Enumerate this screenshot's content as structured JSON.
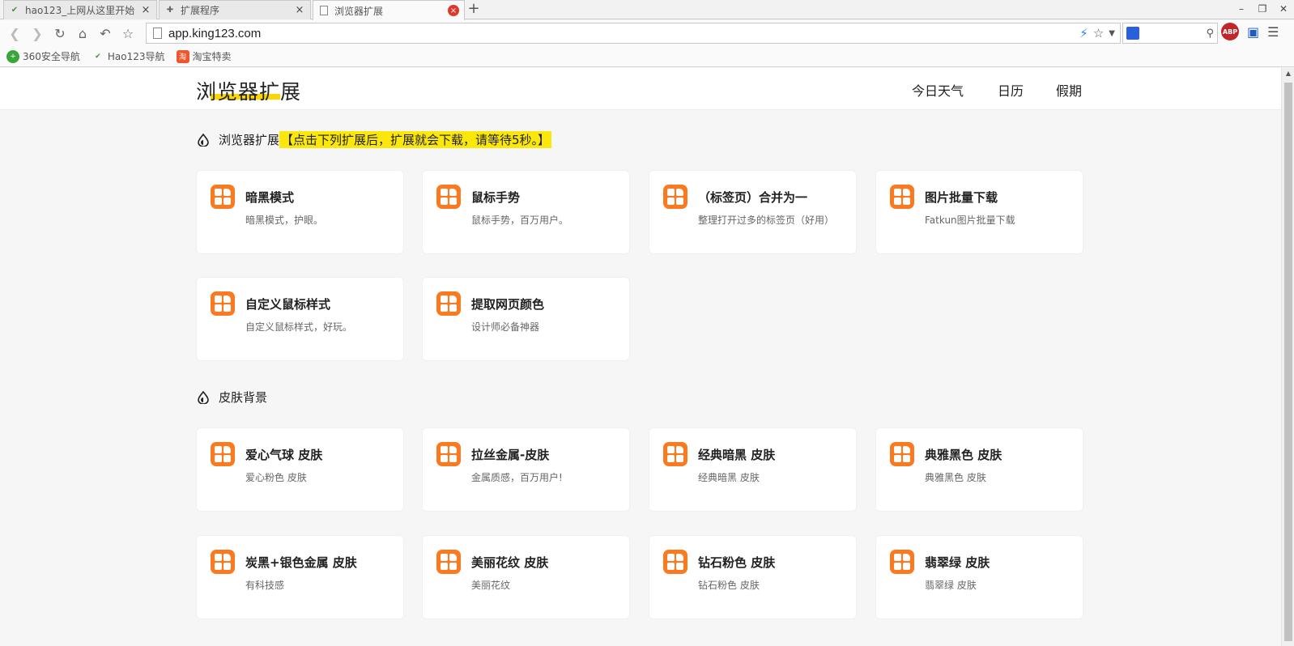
{
  "browser": {
    "tabs": [
      {
        "title": "hao123_上网从这里开始",
        "close": "×"
      },
      {
        "title": "扩展程序",
        "close": "×"
      },
      {
        "title": "浏览器扩展",
        "close": "×"
      }
    ],
    "new_tab": "+",
    "window": {
      "minimize": "–",
      "restore": "❐",
      "close": "✕"
    },
    "url": "app.king123.com",
    "bookmarks": [
      "360安全导航",
      "Hao123导航",
      "淘宝特卖"
    ],
    "abp_label": "ABP"
  },
  "site": {
    "logo": "浏览器扩展",
    "nav": [
      "今日天气",
      "日历",
      "假期"
    ]
  },
  "sections": [
    {
      "title": "浏览器扩展",
      "hint": "【点击下列扩展后，扩展就会下载，请等待5秒。】",
      "cards": [
        {
          "name": "暗黑模式",
          "desc": "暗黑模式，护眼。"
        },
        {
          "name": "鼠标手势",
          "desc": "鼠标手势，百万用户。"
        },
        {
          "name": "（标签页）合并为一",
          "desc": "整理打开过多的标签页（好用）"
        },
        {
          "name": "图片批量下载",
          "desc": "Fatkun图片批量下载"
        },
        {
          "name": "自定义鼠标样式",
          "desc": "自定义鼠标样式，好玩。"
        },
        {
          "name": "提取网页颜色",
          "desc": "设计师必备神器"
        }
      ]
    },
    {
      "title": "皮肤背景",
      "hint": "",
      "cards": [
        {
          "name": "爱心气球  皮肤",
          "desc": "爱心粉色  皮肤"
        },
        {
          "name": "拉丝金属-皮肤",
          "desc": "金属质感，百万用户!"
        },
        {
          "name": "经典暗黑  皮肤",
          "desc": "经典暗黑  皮肤"
        },
        {
          "name": "典雅黑色  皮肤",
          "desc": "典雅黑色  皮肤"
        },
        {
          "name": "炭黑+银色金属  皮肤",
          "desc": "有科技感"
        },
        {
          "name": "美丽花纹  皮肤",
          "desc": "美丽花纹"
        },
        {
          "name": "钻石粉色  皮肤",
          "desc": "钻石粉色  皮肤"
        },
        {
          "name": "翡翠绿  皮肤",
          "desc": "翡翠绿  皮肤"
        }
      ]
    }
  ],
  "colors": {
    "accent": "#fb7a1f",
    "highlight": "#fbe70a",
    "logo_underline": "#fbd600"
  },
  "icons": {
    "card": "extension-grid-icon",
    "section": "drop-icon"
  }
}
